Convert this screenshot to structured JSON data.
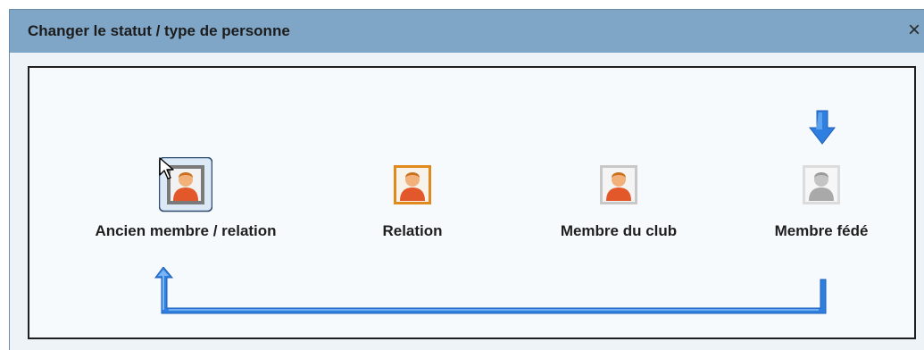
{
  "dialog": {
    "title": "Changer le statut / type de personne",
    "close_glyph": "×"
  },
  "options": [
    {
      "label": "Ancien membre / relation",
      "icon": "person-gray-frame-icon",
      "state": "selected"
    },
    {
      "label": "Relation",
      "icon": "person-orange-frame-icon",
      "state": "normal"
    },
    {
      "label": "Membre du club",
      "icon": "person-gray-frame-icon",
      "state": "normal"
    },
    {
      "label": "Membre fédé",
      "icon": "person-disabled-icon",
      "state": "disabled"
    }
  ],
  "colors": {
    "titlebar": "#7fa6c6",
    "arrow_blue": "#2f7fe0",
    "person_orange": "#e3582a",
    "frame_orange": "#e08a1e"
  }
}
